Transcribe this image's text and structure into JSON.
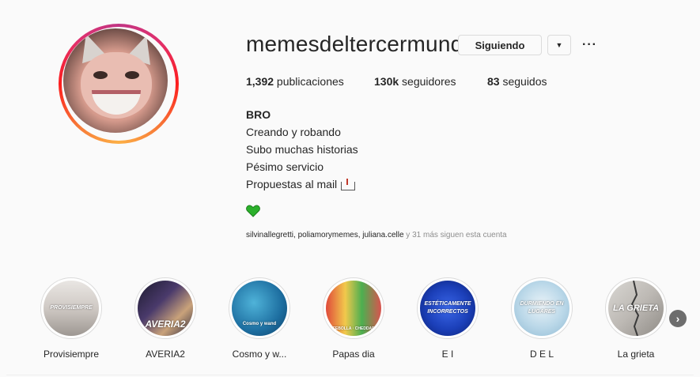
{
  "profile": {
    "username": "memesdeltercermundo",
    "follow_button": "Siguiendo",
    "dropdown_glyph": "▼",
    "more_glyph": "···",
    "stats": {
      "posts_count": "1,392",
      "posts_label": " publicaciones",
      "followers_count": "130k",
      "followers_label": " seguidores",
      "following_count": "83",
      "following_label": " seguidos"
    },
    "bio": {
      "name": "BRO",
      "lines": [
        "Creando y robando",
        "Subo muchas historias",
        "Pésimo servicio",
        "Propuestas al mail"
      ]
    },
    "followed_by": {
      "names": "silvinallegretti, poliamorymemes, juliana.celle",
      "more": " y 31 más siguen esta cuenta"
    }
  },
  "highlights": [
    {
      "label": "Provisiempre",
      "caption": "PROVISIEMPRE"
    },
    {
      "label": "AVERIA2",
      "caption": "AVERIA2"
    },
    {
      "label": "Cosmo y w...",
      "caption": "Cosmo y wand"
    },
    {
      "label": "Papas dia",
      "caption": "CEBOLLA · CHEDDAR"
    },
    {
      "label": "E I",
      "caption": "ESTÉTICAMENTE INCORRECTOS"
    },
    {
      "label": "D E L",
      "caption": "DURMIENDO EN LUGARES"
    },
    {
      "label": "La grieta",
      "caption": "LA GRIETA"
    }
  ],
  "icons": {
    "heart": "green-heart-icon",
    "mailbox": "mailbox-icon",
    "next": "chevron-right-icon"
  },
  "colors": {
    "accent_green": "#2bb02b",
    "text": "#262626",
    "secondary": "#8e8e8e"
  },
  "next_glyph": "›"
}
